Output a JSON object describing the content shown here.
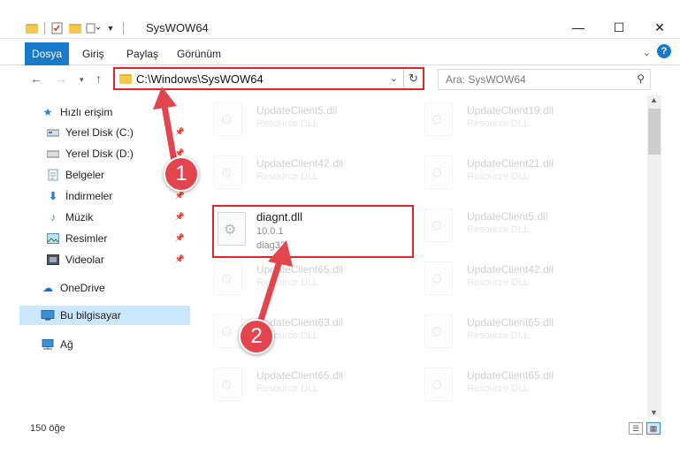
{
  "window": {
    "title": "SysWOW64",
    "minimize": "—",
    "maximize": "☐",
    "close": "✕"
  },
  "ribbon": {
    "tabs": [
      {
        "label": "Dosya",
        "active": true
      },
      {
        "label": "Giriş"
      },
      {
        "label": "Paylaş"
      },
      {
        "label": "Görünüm"
      }
    ],
    "help": "?"
  },
  "nav": {
    "address_path": "C:\\Windows\\SysWOW64",
    "search_placeholder": "Ara: SysWOW64"
  },
  "sidebar": {
    "items": [
      {
        "label": "Hızlı erişim",
        "icon": "star-icon"
      },
      {
        "label": "Yerel Disk (C:)",
        "icon": "drive-icon",
        "pinned": true
      },
      {
        "label": "Yerel Disk (D:)",
        "icon": "drive-icon",
        "pinned": true
      },
      {
        "label": "Belgeler",
        "icon": "documents-icon",
        "pinned": true
      },
      {
        "label": "İndirmeler",
        "icon": "download-icon",
        "pinned": true
      },
      {
        "label": "Müzik",
        "icon": "music-icon",
        "pinned": true
      },
      {
        "label": "Resimler",
        "icon": "pictures-icon",
        "pinned": true
      },
      {
        "label": "Videolar",
        "icon": "videos-icon",
        "pinned": true
      },
      {
        "label": "OneDrive",
        "icon": "cloud-icon"
      },
      {
        "label": "Bu bilgisayar",
        "icon": "computer-icon",
        "selected": true
      },
      {
        "label": "Ağ",
        "icon": "network-icon"
      }
    ]
  },
  "files": {
    "left": [
      {
        "name": "UpdateClient5.dll",
        "type": "Resource DLL"
      },
      {
        "name": "UpdateClient42.dll",
        "type": "Resource DLL"
      },
      {
        "name": "diagnt.dll",
        "version": "10.0.1",
        "desc": "diag32",
        "highlighted": true
      },
      {
        "name": "UpdateClient65.dll",
        "type": "Resource DLL"
      },
      {
        "name": "UpdateClient63.dll",
        "type": "Resource DLL"
      },
      {
        "name": "UpdateClient65.dll",
        "type": "Resource DLL"
      }
    ],
    "right": [
      {
        "name": "UpdateClient19.dll",
        "type": "Resource DLL"
      },
      {
        "name": "UpdateClient21.dll",
        "type": "Resource DLL"
      },
      {
        "name": "UpdateClient5.dll",
        "type": "Resource DLL"
      },
      {
        "name": "UpdateClient42.dll",
        "type": "Resource DLL"
      },
      {
        "name": "UpdateClient65.dll",
        "type": "Resource DLL"
      },
      {
        "name": "UpdateClient65.dll",
        "type": "Resource DLL"
      }
    ]
  },
  "status": {
    "item_count": "150 öğe"
  },
  "annotations": {
    "step1": "1",
    "step2": "2",
    "color": "#e2454d"
  }
}
